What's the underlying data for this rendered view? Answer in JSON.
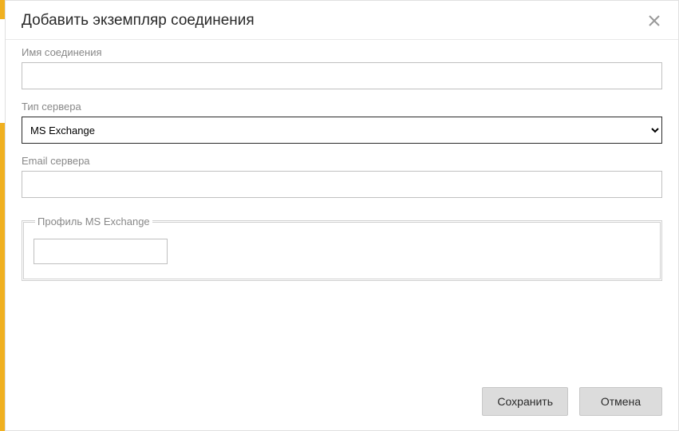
{
  "modal": {
    "title": "Добавить экземпляр соединения"
  },
  "form": {
    "connectionName": {
      "label": "Имя соединения",
      "value": ""
    },
    "serverType": {
      "label": "Тип сервера",
      "value": "MS Exchange",
      "options": [
        "MS Exchange"
      ]
    },
    "serverEmail": {
      "label": "Email сервера",
      "value": ""
    },
    "profile": {
      "legend": "Профиль MS Exchange",
      "value": ""
    }
  },
  "footer": {
    "saveLabel": "Сохранить",
    "cancelLabel": "Отмена"
  }
}
